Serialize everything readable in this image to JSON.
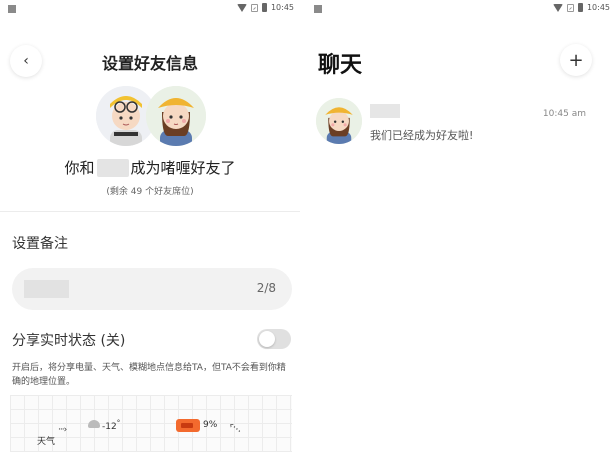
{
  "status_bar": {
    "time": "10:45"
  },
  "left_panel": {
    "back_icon": "chevron-left-icon",
    "title": "设置好友信息",
    "friend_line_prefix": "你和",
    "friend_line_suffix": "成为啫喱好友了",
    "remaining_slots": "(剩余 49 个好友席位)",
    "remark_label": "设置备注",
    "remark_count": "2/8",
    "share_label": "分享实时状态 (关)",
    "share_toggle_on": false,
    "share_desc": "开启后，将分享电量、天气、模糊地点信息给TA，但TA不会看到你精确的地理位置。",
    "preview": {
      "weather_label": "天气",
      "temperature": "-12",
      "degree": "°",
      "battery": "9%"
    }
  },
  "right_panel": {
    "title": "聊天",
    "add_icon": "plus-icon",
    "chat_items": [
      {
        "message": "我们已经成为好友啦!",
        "time": "10:45 am"
      }
    ]
  },
  "colors": {
    "battery_badge": "#f36a2e",
    "toggle_off": "#e0e0e0"
  }
}
